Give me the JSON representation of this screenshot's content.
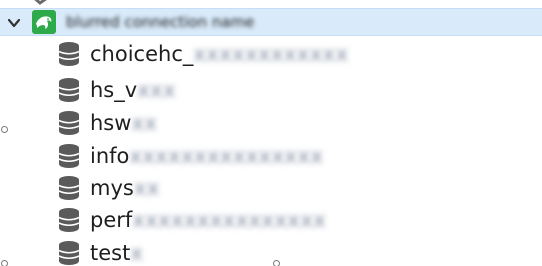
{
  "connection": {
    "label": "blurred connection name",
    "expanded": true,
    "icon": "mysql-dolphin-icon"
  },
  "databases": [
    {
      "visible": "choicehc_",
      "obscured": "xxxxxxxxxxxx",
      "icon": "database-icon"
    },
    {
      "visible": "hs_v",
      "obscured": "xxx",
      "icon": "database-icon"
    },
    {
      "visible": "hsw",
      "obscured": "xx",
      "icon": "database-icon"
    },
    {
      "visible": "info",
      "obscured": "xxxxxxxxxxxxxxx",
      "icon": "database-icon"
    },
    {
      "visible": "mys",
      "obscured": "xx",
      "icon": "database-icon"
    },
    {
      "visible": "perf",
      "obscured": "xxxxxxxxxxxxxxx",
      "icon": "database-icon"
    },
    {
      "visible": "test",
      "obscured": "x",
      "icon": "database-icon"
    }
  ],
  "colors": {
    "selected_row": "#d9ebfb",
    "connection_icon_bg": "#2eaa4a",
    "database_icon": "#5a5a5a",
    "text": "#1e1e1e"
  }
}
